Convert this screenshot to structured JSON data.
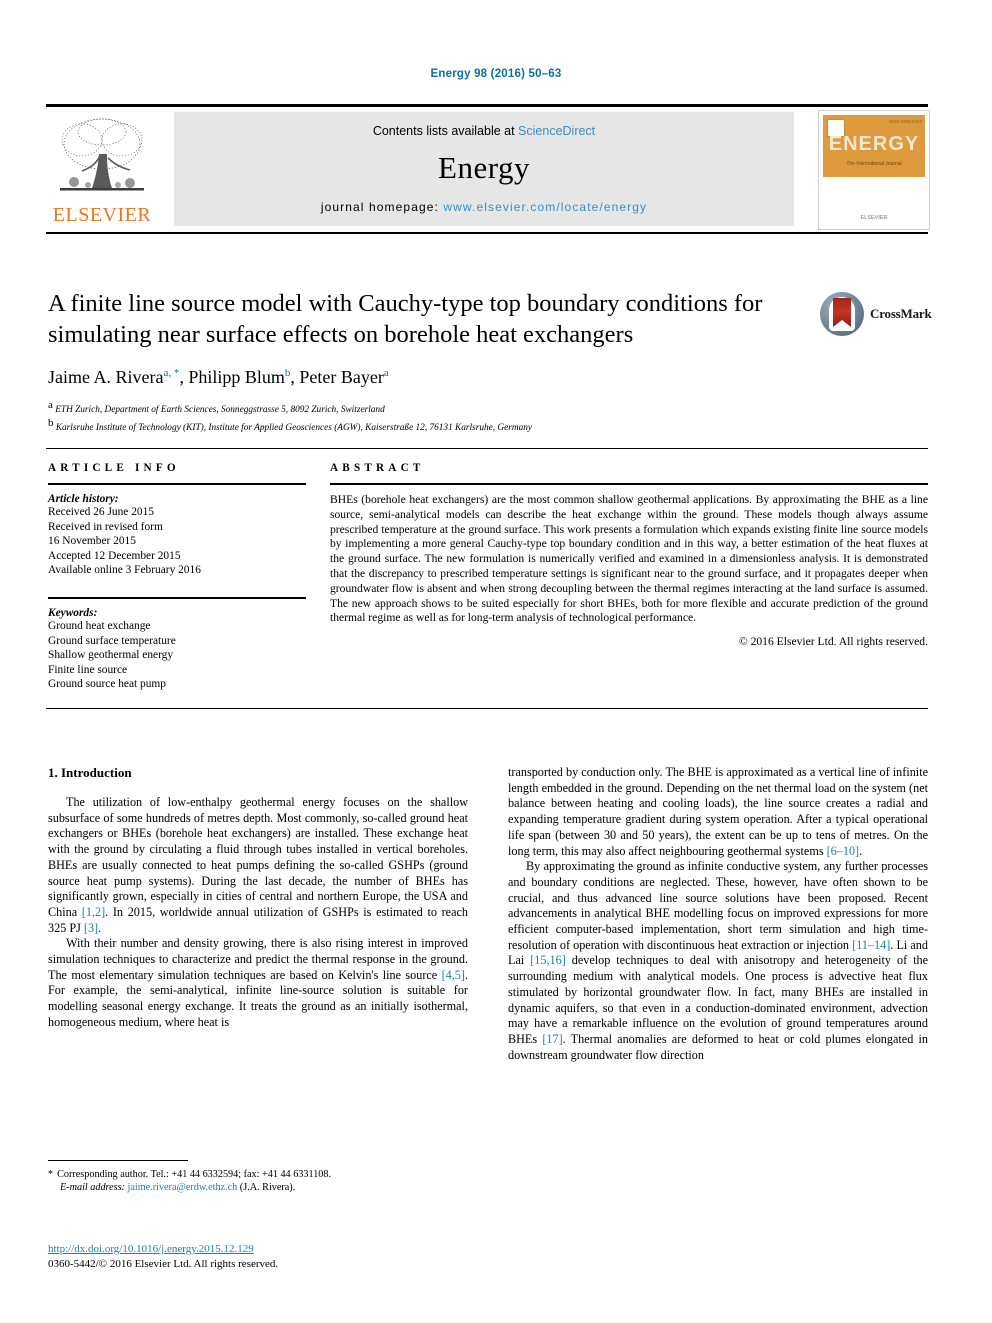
{
  "running_head": "Energy 98 (2016) 50–63",
  "masthead": {
    "contents_prefix": "Contents lists available at ",
    "sciencedirect": "ScienceDirect",
    "journal_name": "Energy",
    "homepage_label": "journal homepage: ",
    "homepage_url": "www.elsevier.com/locate/energy",
    "publisher_logo_text": "ELSEVIER",
    "publisher_logo_icon": "elsevier-tree-icon",
    "cover": {
      "title": "ENERGY",
      "subtitle": "The International Journal",
      "publisher": "ELSEVIER",
      "corner_label": "ISSN 0360-5442"
    }
  },
  "article": {
    "title": "A finite line source model with Cauchy-type top boundary conditions for simulating near surface effects on borehole heat exchangers",
    "authors": [
      {
        "name": "Jaime A. Rivera",
        "marks": "a, *"
      },
      {
        "name": "Philipp Blum",
        "marks": "b"
      },
      {
        "name": "Peter Bayer",
        "marks": "a"
      }
    ],
    "authors_line_plain": "Jaime A. Rivera a, *, Philipp Blum b, Peter Bayer a",
    "affiliations": [
      {
        "mark": "a",
        "text": "ETH Zurich, Department of Earth Sciences, Sonneggstrasse 5, 8092 Zurich, Switzerland"
      },
      {
        "mark": "b",
        "text": "Karlsruhe Institute of Technology (KIT), Institute for Applied Geosciences (AGW), Kaiserstraße 12, 76131 Karlsruhe, Germany"
      }
    ],
    "crossmark_label": "CrossMark"
  },
  "article_info": {
    "heading": "ARTICLE INFO",
    "history_label": "Article history:",
    "history": [
      "Received 26 June 2015",
      "Received in revised form",
      "16 November 2015",
      "Accepted 12 December 2015",
      "Available online 3 February 2016"
    ],
    "keywords_label": "Keywords:",
    "keywords": [
      "Ground heat exchange",
      "Ground surface temperature",
      "Shallow geothermal energy",
      "Finite line source",
      "Ground source heat pump"
    ]
  },
  "abstract": {
    "heading": "ABSTRACT",
    "text": "BHEs (borehole heat exchangers) are the most common shallow geothermal applications. By approximating the BHE as a line source, semi-analytical models can describe the heat exchange within the ground. These models though always assume prescribed temperature at the ground surface. This work presents a formulation which expands existing finite line source models by implementing a more general Cauchy-type top boundary condition and in this way, a better estimation of the heat fluxes at the ground surface. The new formulation is numerically verified and examined in a dimensionless analysis. It is demonstrated that the discrepancy to prescribed temperature settings is significant near to the ground surface, and it propagates deeper when groundwater flow is absent and when strong decoupling between the thermal regimes interacting at the land surface is assumed. The new approach shows to be suited especially for short BHEs, both for more flexible and accurate prediction of the ground thermal regime as well as for long-term analysis of technological performance.",
    "copyright": "© 2016 Elsevier Ltd. All rights reserved."
  },
  "body": {
    "section_heading": "1. Introduction",
    "left_paragraphs": [
      "The utilization of low-enthalpy geothermal energy focuses on the shallow subsurface of some hundreds of metres depth. Most commonly, so-called ground heat exchangers or BHEs (borehole heat exchangers) are installed. These exchange heat with the ground by circulating a fluid through tubes installed in vertical boreholes. BHEs are usually connected to heat pumps defining the so-called GSHPs (ground source heat pump systems). During the last decade, the number of BHEs has significantly grown, especially in cities of central and northern Europe, the USA and China [1,2]. In 2015, worldwide annual utilization of GSHPs is estimated to reach 325 PJ [3].",
      "With their number and density growing, there is also rising interest in improved simulation techniques to characterize and predict the thermal response in the ground. The most elementary simulation techniques are based on Kelvin's line source [4,5]. For example, the semi-analytical, infinite line-source solution is suitable for modelling seasonal energy exchange. It treats the ground as an initially isothermal, homogeneous medium, where heat is"
    ],
    "right_paragraphs": [
      "transported by conduction only. The BHE is approximated as a vertical line of infinite length embedded in the ground. Depending on the net thermal load on the system (net balance between heating and cooling loads), the line source creates a radial and expanding temperature gradient during system operation. After a typical operational life span (between 30 and 50 years), the extent can be up to tens of metres. On the long term, this may also affect neighbouring geothermal systems [6–10].",
      "By approximating the ground as infinite conductive system, any further processes and boundary conditions are neglected. These, however, have often shown to be crucial, and thus advanced line source solutions have been proposed. Recent advancements in analytical BHE modelling focus on improved expressions for more efficient computer-based implementation, short term simulation and high time-resolution of operation with discontinuous heat extraction or injection [11–14]. Li and Lai [15,16] develop techniques to deal with anisotropy and heterogeneity of the surrounding medium with analytical models. One process is advective heat flux stimulated by horizontal groundwater flow. In fact, many BHEs are installed in dynamic aquifers, so that even in a conduction-dominated environment, advection may have a remarkable influence on the evolution of ground temperatures around BHEs [17]. Thermal anomalies are deformed to heat or cold plumes elongated in downstream groundwater flow direction"
    ]
  },
  "footnote": {
    "star": "*",
    "corresponding": "Corresponding author. Tel.: +41 44 6332594; fax: +41 44 6331108.",
    "email_label": "E-mail address:",
    "email": "jaime.rivera@erdw.ethz.ch",
    "email_owner": "(J.A. Rivera)."
  },
  "doi": {
    "url": "http://dx.doi.org/10.1016/j.energy.2015.12.129",
    "issn_line": "0360-5442/© 2016 Elsevier Ltd. All rights reserved."
  },
  "colors": {
    "link_blue": "#1a7fb5",
    "header_blue": "#0b6ea8",
    "sciencedirect_blue": "#3a8ec2",
    "elsevier_orange": "#e87722",
    "masthead_gray": "#e6e6e6",
    "cover_orange": "#e09a3e"
  }
}
